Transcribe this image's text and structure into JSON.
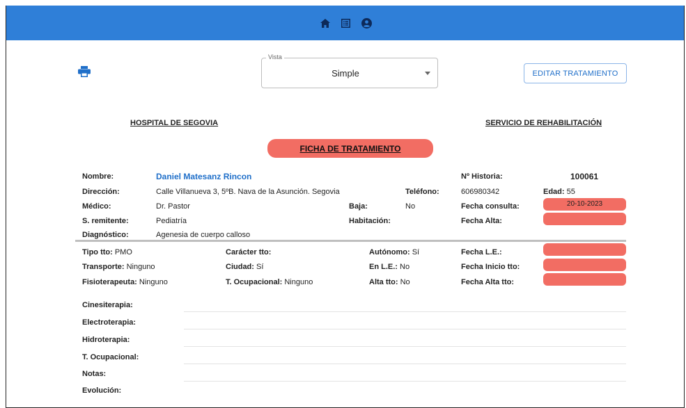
{
  "nav": {
    "icons": [
      "home-icon",
      "list-icon",
      "account-icon"
    ]
  },
  "toolbar": {
    "vista_label": "Vista",
    "vista_value": "Simple",
    "edit_button": "EDITAR TRATAMIENTO"
  },
  "header": {
    "hospital": "HOSPITAL DE SEGOVIA",
    "service": "SERVICIO DE REHABILITACIÓN",
    "title": "FICHA DE TRATAMIENTO"
  },
  "patient": {
    "nombre_label": "Nombre:",
    "nombre": "Daniel Matesanz Rincon",
    "direccion_label": "Dirección:",
    "direccion": "Calle Villanueva 3, 5ºB. Nava de la Asunción. Segovia",
    "telefono_label": "Teléfono:",
    "telefono": "606980342",
    "medico_label": "Médico:",
    "medico": "Dr. Pastor",
    "baja_label": "Baja:",
    "baja": "No",
    "remitente_label": "S. remitente:",
    "remitente": "Pediatría",
    "habitacion_label": "Habitación:",
    "diagnostico_label": "Diagnóstico:",
    "diagnostico": "Agenesia de cuerpo calloso",
    "historia_label": "Nº Historia:",
    "historia": "100061",
    "edad_label": "Edad:",
    "edad": "55",
    "fecha_consulta_label": "Fecha consulta:",
    "fecha_consulta": "20-10-2023",
    "fecha_alta_label": "Fecha Alta:"
  },
  "treatment": {
    "tipo_label": "Tipo tto:",
    "tipo": "PMO",
    "caracter_label": "Carácter tto:",
    "autonomo_label": "Autónomo:",
    "autonomo": "Sí",
    "fecha_le_label": "Fecha L.E.:",
    "transporte_label": "Transporte:",
    "transporte": "Ninguno",
    "ciudad_label": "Ciudad:",
    "ciudad": "Sí",
    "en_le_label": "En L.E.:",
    "en_le": "No",
    "fecha_inicio_label": "Fecha Inicio tto:",
    "fisio_label": "Fisioterapeuta:",
    "fisio": "Ninguno",
    "t_ocup_label": "T. Ocupacional:",
    "t_ocup": "Ninguno",
    "alta_tto_label": "Alta tto:",
    "alta_tto": "No",
    "fecha_alta_tto_label": "Fecha Alta tto:"
  },
  "sections": [
    "Cinesiterapia:",
    "Electroterapia:",
    "Hidroterapia:",
    "T. Ocupacional:",
    "Notas:",
    "Evolución:"
  ],
  "colors": {
    "topbar": "#2f7fd8",
    "highlight": "#f26d63",
    "link": "#1f6fc9"
  }
}
